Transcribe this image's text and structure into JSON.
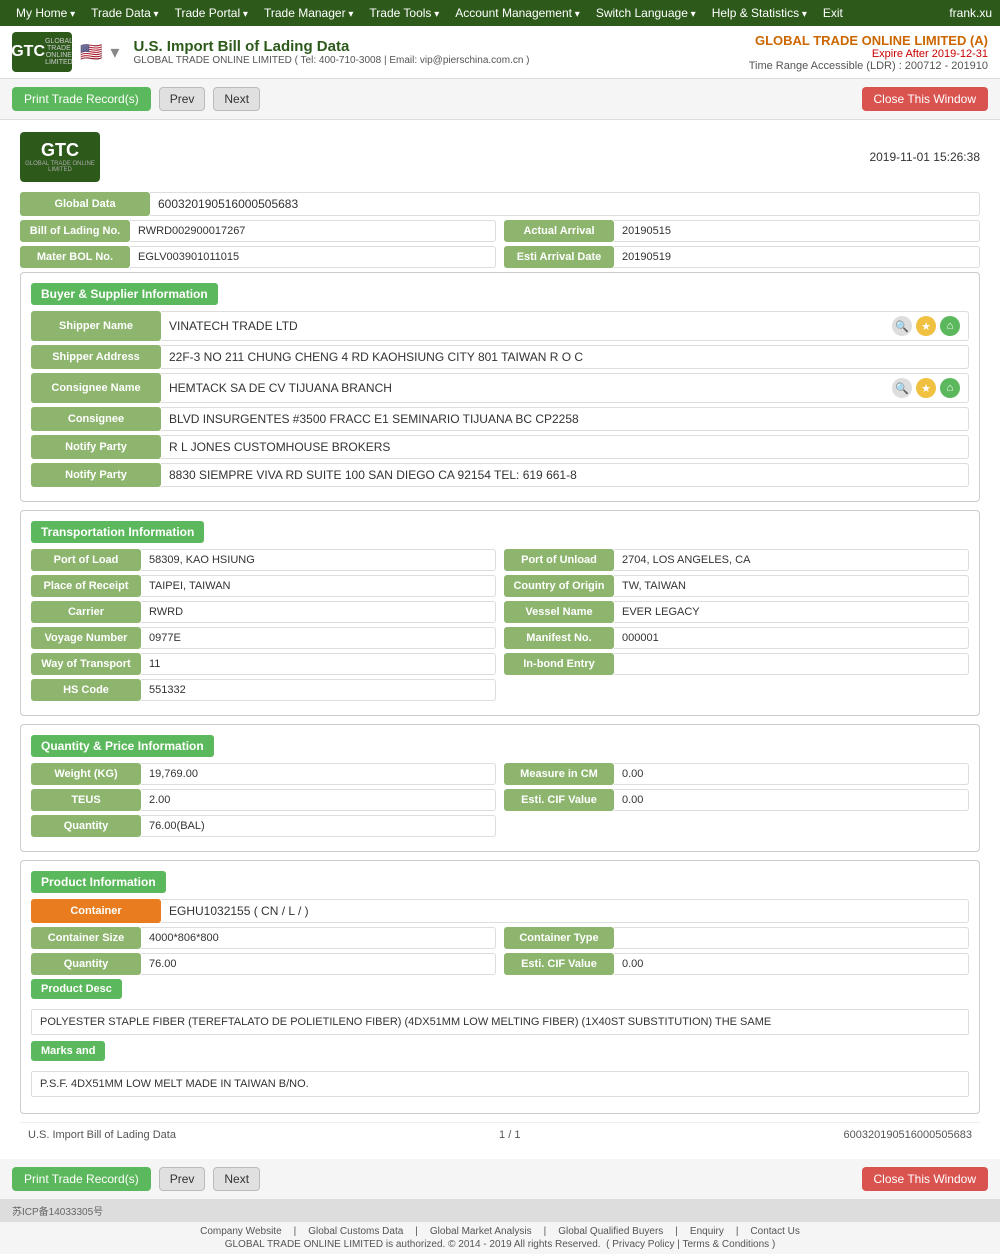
{
  "nav": {
    "items": [
      "My Home",
      "Trade Data",
      "Trade Portal",
      "Trade Manager",
      "Trade Tools",
      "Account Management",
      "Switch Language",
      "Help & Statistics",
      "Exit"
    ],
    "user": "frank.xu"
  },
  "header": {
    "title": "U.S. Import Bill of Lading Data",
    "contact": "GLOBAL TRADE ONLINE LIMITED ( Tel: 400-710-3008 | Email: vip@pierschina.com.cn )",
    "company": "GLOBAL TRADE ONLINE LIMITED (A)",
    "expire": "Expire After 2019-12-31",
    "ldr": "Time Range Accessible (LDR) : 200712 - 201910"
  },
  "toolbar": {
    "print_label": "Print Trade Record(s)",
    "prev_label": "Prev",
    "next_label": "Next",
    "close_label": "Close This Window"
  },
  "record": {
    "datetime": "2019-11-01 15:26:38",
    "global_data_label": "Global Data",
    "global_data_value": "600320190516000505683",
    "bol_label": "Bill of Lading No.",
    "bol_value": "RWRD002900017267",
    "actual_arrival_label": "Actual Arrival",
    "actual_arrival_value": "20190515",
    "master_bol_label": "Mater BOL No.",
    "master_bol_value": "EGLV003901011015",
    "esti_arrival_label": "Esti Arrival Date",
    "esti_arrival_value": "20190519",
    "sections": {
      "buyer_supplier": {
        "title": "Buyer & Supplier Information",
        "fields": [
          {
            "label": "Shipper Name",
            "value": "VINATECH TRADE LTD",
            "has_icons": true
          },
          {
            "label": "Shipper Address",
            "value": "22F-3 NO 211 CHUNG CHENG 4 RD KAOHSIUNG CITY 801 TAIWAN R O C",
            "has_icons": false
          },
          {
            "label": "Consignee Name",
            "value": "HEMTACK SA DE CV TIJUANA BRANCH",
            "has_icons": true
          },
          {
            "label": "Consignee",
            "value": "BLVD INSURGENTES #3500 FRACC E1 SEMINARIO TIJUANA BC CP2258",
            "has_icons": false
          },
          {
            "label": "Notify Party",
            "value": "R L JONES CUSTOMHOUSE BROKERS",
            "has_icons": false
          },
          {
            "label": "Notify Party",
            "value": "8830 SIEMPRE VIVA RD SUITE 100 SAN DIEGO CA 92154 TEL: 619 661-8",
            "has_icons": false
          }
        ]
      },
      "transportation": {
        "title": "Transportation Information",
        "fields_left": [
          {
            "label": "Port of Load",
            "value": "58309, KAO HSIUNG"
          },
          {
            "label": "Place of Receipt",
            "value": "TAIPEI, TAIWAN"
          },
          {
            "label": "Carrier",
            "value": "RWRD"
          },
          {
            "label": "Voyage Number",
            "value": "0977E"
          },
          {
            "label": "Way of Transport",
            "value": "11"
          },
          {
            "label": "HS Code",
            "value": "551332"
          }
        ],
        "fields_right": [
          {
            "label": "Port of Unload",
            "value": "2704, LOS ANGELES, CA"
          },
          {
            "label": "Country of Origin",
            "value": "TW, TAIWAN"
          },
          {
            "label": "Vessel Name",
            "value": "EVER LEGACY"
          },
          {
            "label": "Manifest No.",
            "value": "000001"
          },
          {
            "label": "In-bond Entry",
            "value": ""
          }
        ]
      },
      "quantity_price": {
        "title": "Quantity & Price Information",
        "fields": [
          {
            "label_left": "Weight (KG)",
            "value_left": "19,769.00",
            "label_right": "Measure in CM",
            "value_right": "0.00"
          },
          {
            "label_left": "TEUS",
            "value_left": "2.00",
            "label_right": "Esti. CIF Value",
            "value_right": "0.00"
          },
          {
            "label_left": "Quantity",
            "value_left": "76.00(BAL)",
            "label_right": "",
            "value_right": ""
          }
        ]
      },
      "product": {
        "title": "Product Information",
        "container_label": "Container",
        "container_value": "EGHU1032155 ( CN / L / )",
        "container_size_label": "Container Size",
        "container_size_value": "4000*806*800",
        "container_type_label": "Container Type",
        "container_type_value": "",
        "quantity_label": "Quantity",
        "quantity_value": "76.00",
        "esti_cif_label": "Esti. CIF Value",
        "esti_cif_value": "0.00",
        "product_desc_label": "Product Desc",
        "product_desc_value": "POLYESTER STAPLE FIBER (TEREFTALATO DE POLIETILENO FIBER) (4DX51MM LOW MELTING FIBER) (1X40ST SUBSTITUTION) THE SAME",
        "marks_label": "Marks and",
        "marks_value": "P.S.F. 4DX51MM LOW MELT MADE IN TAIWAN B/NO."
      }
    },
    "footer": {
      "left": "U.S. Import Bill of Lading Data",
      "middle": "1 / 1",
      "right": "600320190516000505683"
    }
  },
  "bottom": {
    "icp": "苏ICP备14033305号",
    "links": [
      "Company Website",
      "Global Customs Data",
      "Global Market Analysis",
      "Global Qualified Buyers",
      "Enquiry",
      "Contact Us"
    ],
    "copyright": "GLOBAL TRADE ONLINE LIMITED is authorized. © 2014 - 2019 All rights Reserved.",
    "policy_links": [
      "Privacy Policy",
      "Terms & Conditions"
    ]
  }
}
